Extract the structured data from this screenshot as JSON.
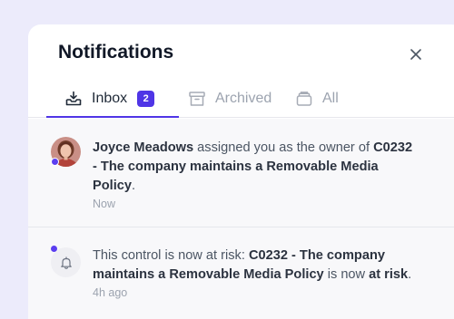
{
  "panel": {
    "title": "Notifications"
  },
  "tabs": [
    {
      "label": "Inbox",
      "badge": "2",
      "icon": "inbox-icon",
      "active": true
    },
    {
      "label": "Archived",
      "icon": "archive-icon",
      "active": false
    },
    {
      "label": "All",
      "icon": "stack-icon",
      "active": false
    }
  ],
  "notifications": [
    {
      "actor": "Joyce Meadows",
      "text_1": " assigned you as the owner of ",
      "control": "C0232 - The company maintains a Removable Media Policy",
      "text_2": ".",
      "time": "Now",
      "unread": true,
      "icon": "avatar"
    },
    {
      "text_1": "This control is now at risk: ",
      "control": "C0232 - The company maintains a Removable Media Policy",
      "text_2": " is now ",
      "status": "at risk",
      "text_3": ".",
      "time": "4h ago",
      "unread": true,
      "icon": "bell-icon"
    }
  ],
  "colors": {
    "accent": "#4f35e6",
    "background": "#ecebfb",
    "item_background": "#f8f8fa"
  }
}
